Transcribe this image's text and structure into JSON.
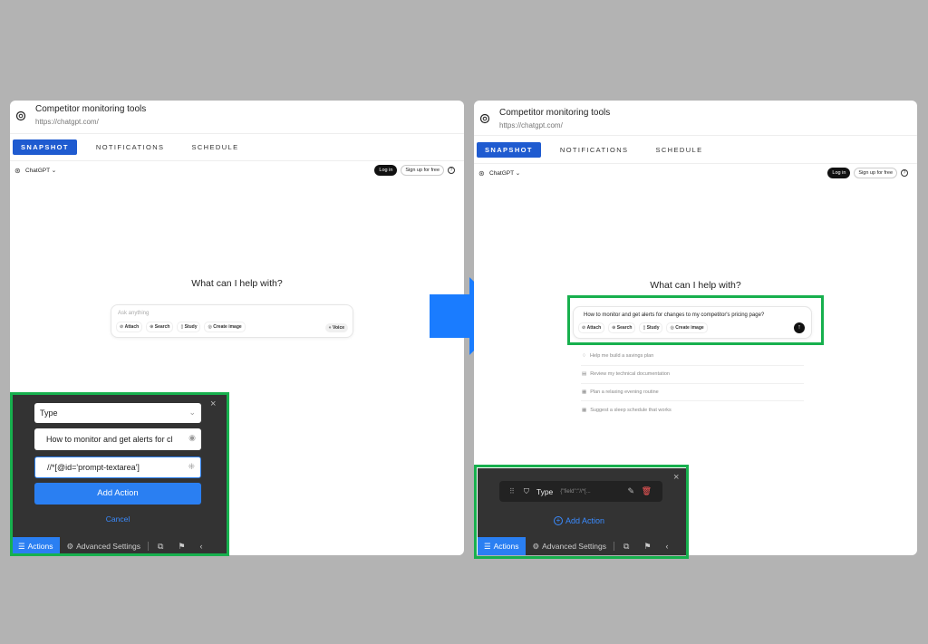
{
  "site": {
    "title": "Competitor monitoring tools",
    "url": "https://chatgpt.com/"
  },
  "tabs": [
    "SNAPSHOT",
    "NOTIFICATIONS",
    "SCHEDULE"
  ],
  "chatgpt": {
    "name": "ChatGPT",
    "login": "Log in",
    "signup": "Sign up for free",
    "hero": "What can I help with?",
    "placeholder": "Ask anything",
    "prompt_filled": "How to monitor and get alerts for changes to my competitor's pricing page?",
    "chips": [
      "Attach",
      "Search",
      "Study",
      "Create image"
    ],
    "voice": "Voice",
    "suggestions": [
      "Help me build a savings plan",
      "Review my technical documentation",
      "Plan a relaxing evening routine",
      "Suggest a sleep schedule that works"
    ]
  },
  "left_panel": {
    "type_select": "Type",
    "text_value": "How to monitor and get alerts for cl",
    "xpath_value": "//*[@id='prompt-textarea']",
    "add_action": "Add Action",
    "cancel": "Cancel"
  },
  "right_panel": {
    "action_type": "Type",
    "action_payload": "{\"field\":\"//*[...",
    "add_action": "Add Action"
  },
  "bottom_bar": {
    "actions": "Actions",
    "advanced_settings": "Advanced Settings"
  },
  "colors": {
    "background": "#b3b3b3",
    "accent_blue": "#2a7ff2",
    "tab_active": "#1f5bd0",
    "highlight_green": "#17b04e",
    "panel_dark": "#333333",
    "arrow_blue": "#1a7cff"
  },
  "icons": [
    "openai-logo-icon",
    "chevron-down-icon",
    "help-icon",
    "paperclip-icon",
    "globe-icon",
    "book-icon",
    "palette-icon",
    "voice-icon",
    "send-arrow-icon",
    "close-icon",
    "eye-icon",
    "pointer-select-icon",
    "list-icon",
    "gear-icon",
    "external-link-icon",
    "flag-icon",
    "chevron-left-icon",
    "drag-handle-icon",
    "shield-icon",
    "pencil-icon",
    "trash-icon",
    "plus-circle-icon",
    "arrow-right-icon"
  ]
}
